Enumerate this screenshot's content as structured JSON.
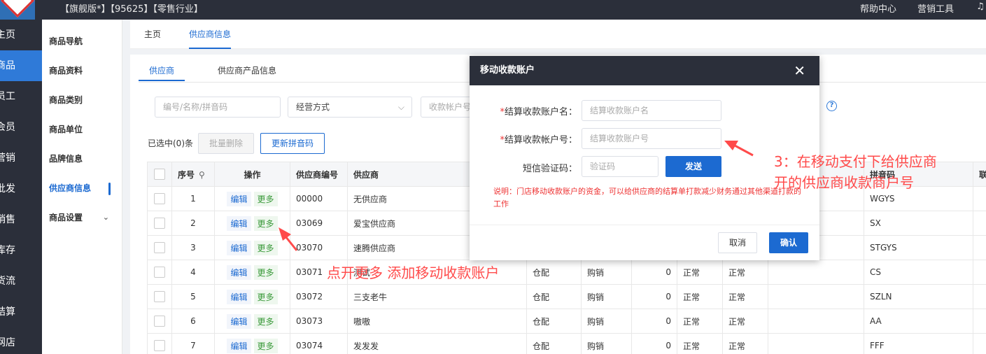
{
  "topbar": {
    "title": "【旗舰版*】【95625】【零售行业】",
    "help": "帮助中心",
    "marketing": "营销工具",
    "bell_icon": "bell-icon"
  },
  "leftnav": [
    "主页",
    "商品",
    "员工",
    "会员",
    "营销",
    "批发",
    "销售",
    "库存",
    "货流",
    "结算",
    "网店"
  ],
  "subnav": {
    "items": [
      "商品导航",
      "商品资料",
      "商品类别",
      "商品单位",
      "品牌信息",
      "供应商信息",
      "商品设置"
    ]
  },
  "tabs": {
    "home": "主页",
    "supplier_info": "供应商信息"
  },
  "subtabs": {
    "supplier": "供应商",
    "supplier_products": "供应商产品信息"
  },
  "filters": {
    "search_placeholder": "编号/名称/拼音码",
    "mode_select": "经营方式",
    "account_placeholder": "收款帐户号"
  },
  "toolbar": {
    "selected": "已选中(0)条",
    "batch_delete": "批量删除",
    "update_pinyin": "更新拼音码"
  },
  "table": {
    "headers": {
      "seq": "序号",
      "ops": "操作",
      "code": "供应商编号",
      "name": "供应商",
      "pinyin": "拼音码",
      "contact": "联"
    },
    "op_labels": {
      "edit": "编辑",
      "more": "更多"
    },
    "rows": [
      {
        "seq": "1",
        "code": "00000",
        "name": "无供应商",
        "mode": "",
        "type": "",
        "num": "",
        "s1": "",
        "s2": "",
        "pinyin": "WGYS"
      },
      {
        "seq": "2",
        "code": "03069",
        "name": "爱宝供应商",
        "mode": "",
        "type": "",
        "num": "",
        "s1": "",
        "s2": "",
        "pinyin": "SX"
      },
      {
        "seq": "3",
        "code": "03070",
        "name": "速腾供应商",
        "mode": "",
        "type": "",
        "num": "",
        "s1": "",
        "s2": "",
        "pinyin": "STGYS"
      },
      {
        "seq": "4",
        "code": "03071",
        "name": "测试",
        "mode": "仓配",
        "type": "购销",
        "num": "0",
        "s1": "正常",
        "s2": "正常",
        "pinyin": "CS"
      },
      {
        "seq": "5",
        "code": "03072",
        "name": "三支老牛",
        "mode": "仓配",
        "type": "购销",
        "num": "0",
        "s1": "正常",
        "s2": "正常",
        "pinyin": "SZLN"
      },
      {
        "seq": "6",
        "code": "03073",
        "name": "嗷嗷",
        "mode": "仓配",
        "type": "购销",
        "num": "0",
        "s1": "正常",
        "s2": "正常",
        "pinyin": "AA"
      },
      {
        "seq": "7",
        "code": "03074",
        "name": "发发发",
        "mode": "仓配",
        "type": "购销",
        "num": "0",
        "s1": "正常",
        "s2": "正常",
        "pinyin": "FFF"
      }
    ]
  },
  "modal": {
    "title": "移动收款账户",
    "account_name_label": "结算收款账户名：",
    "account_name_placeholder": "结算收款账户名",
    "account_no_label": "结算收款帐户号：",
    "account_no_placeholder": "结算收款账户号",
    "sms_label": "短信验证码：",
    "sms_placeholder": "验证码",
    "send": "发送",
    "note": "说明：门店移动收款账户的资金，可以给供应商的结算单打款减少财务通过其他渠道打款的工作",
    "cancel": "取消",
    "confirm": "确认"
  },
  "annotations": {
    "step3_line1": "3：在移动支付下给供应商",
    "step3_line2": "开的供应商收款商户号",
    "click_more": "点开更多 添加移动收款账户"
  },
  "colors": {
    "primary": "#1c6ad1",
    "dark": "#2b2f3a",
    "annotation": "#ff4a4a"
  }
}
